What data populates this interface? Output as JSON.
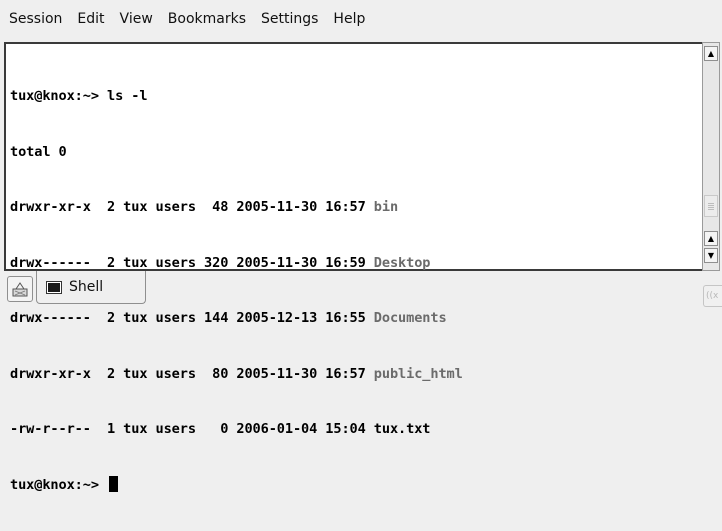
{
  "menubar": {
    "items": [
      "Session",
      "Edit",
      "View",
      "Bookmarks",
      "Settings",
      "Help"
    ]
  },
  "terminal": {
    "lines": [
      {
        "text": "tux@knox:~> ls -l",
        "dir": ""
      },
      {
        "text": "total 0",
        "dir": ""
      },
      {
        "text": "drwxr-xr-x  2 tux users  48 2005-11-30 16:57 ",
        "dir": "bin"
      },
      {
        "text": "drwx------  2 tux users 320 2005-11-30 16:59 ",
        "dir": "Desktop"
      },
      {
        "text": "drwx------  2 tux users 144 2005-12-13 16:55 ",
        "dir": "Documents"
      },
      {
        "text": "drwxr-xr-x  2 tux users  80 2005-11-30 16:57 ",
        "dir": "public_html"
      },
      {
        "text": "-rw-r--r--  1 tux users   0 2006-01-04 15:04 tux.txt",
        "dir": ""
      }
    ],
    "prompt": "tux@knox:~> "
  },
  "scrollbar": {
    "up_arrow": "▲",
    "down_arrow": "▼"
  },
  "tabbar": {
    "tabs": [
      {
        "label": "Shell"
      }
    ],
    "icons": {
      "new_tab": "new-session-icon",
      "tab": "terminal-icon",
      "close": "close-tab-icon"
    },
    "close_glyph": "((x"
  },
  "colors": {
    "directory": "#6b6b6b",
    "terminal_bg": "#ffffff",
    "chrome_bg": "#efefef"
  }
}
